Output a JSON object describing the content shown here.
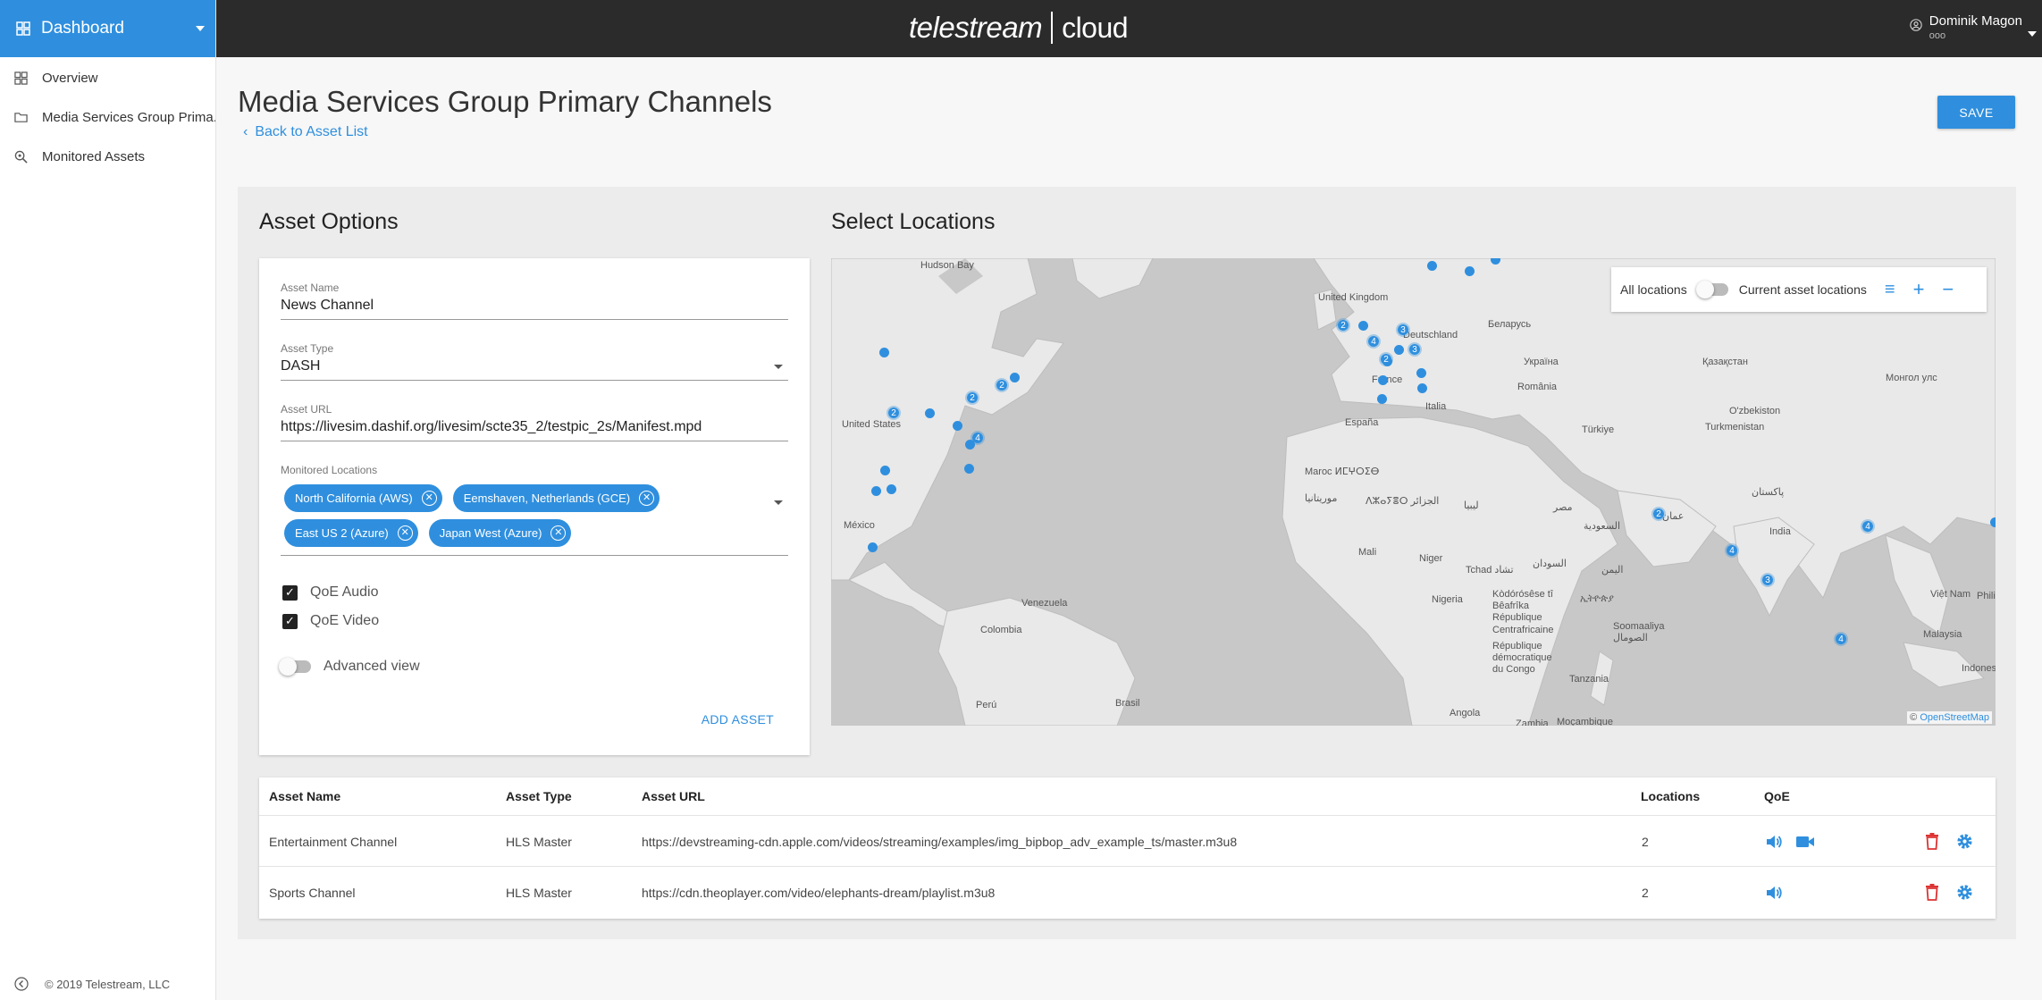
{
  "sidebar": {
    "header": "Dashboard",
    "items": [
      {
        "label": "Overview"
      },
      {
        "label": "Media Services Group Prima..."
      },
      {
        "label": "Monitored Assets"
      }
    ],
    "footer": "© 2019 Telestream, LLC"
  },
  "topbar": {
    "logo_brand": "telestream",
    "logo_product": "cloud",
    "user_name": "Dominik Magon",
    "user_sub": "ooo"
  },
  "page": {
    "title": "Media Services Group Primary Channels",
    "back_link": "Back to Asset List",
    "save_label": "SAVE"
  },
  "asset_options": {
    "heading": "Asset Options",
    "asset_name_label": "Asset Name",
    "asset_name": "News Channel",
    "asset_type_label": "Asset Type",
    "asset_type": "DASH",
    "asset_url_label": "Asset URL",
    "asset_url": "https://livesim.dashif.org/livesim/scte35_2/testpic_2s/Manifest.mpd",
    "monitored_label": "Monitored Locations",
    "locations": [
      "North California (AWS)",
      "Eemshaven, Netherlands (GCE)",
      "East US 2 (Azure)",
      "Japan West (Azure)"
    ],
    "qoe_audio": "QoE Audio",
    "qoe_video": "QoE Video",
    "advanced_view": "Advanced view",
    "add_asset": "ADD ASSET"
  },
  "map": {
    "heading": "Select Locations",
    "all_locations": "All locations",
    "current_locations": "Current asset locations",
    "attribution_prefix": "©",
    "attribution_link": "OpenStreetMap",
    "labels": [
      "Hudson Bay",
      "United Kingdom",
      "Deutschland",
      "Беларусь",
      "Україна",
      "Қазақстан",
      "Монгол улс",
      "United States",
      "France",
      "España",
      "Italia",
      "România",
      "Türkiye",
      "O'zbekiston",
      "Turkmenistan",
      "پاکستان",
      "India",
      "México",
      "Maroc ⵍⵎⵖⵔⵉⴱ",
      "ⴷⵣⴰⵢⴻⵔ الجزائر",
      "ليبيا",
      "مصر",
      "السعودية",
      "عمان",
      "Mali",
      "Niger",
      "Tchad تشاد",
      "السودان",
      "اليمن",
      "Venezuela",
      "Colombia",
      "Nigeria",
      "Kòdórósêse tî Bêafrîka République Centrafricaine",
      "ኢትዮጵያ",
      "Soomaaliya الصومال",
      "République démocratique du Congo",
      "Tanzania",
      "Perú",
      "Brasil",
      "Angola",
      "Zambia",
      "Moçambique",
      "Việt Nam",
      "Malaysia",
      "Indonesia",
      "موريتانيا",
      "Philip"
    ],
    "clusters": [
      "2",
      "2",
      "2",
      "4",
      "2",
      "4",
      "3",
      "3",
      "2",
      "4",
      "2",
      "4",
      "4",
      "3"
    ]
  },
  "table": {
    "headers": [
      "Asset Name",
      "Asset Type",
      "Asset URL",
      "Locations",
      "QoE"
    ],
    "rows": [
      {
        "name": "Entertainment Channel",
        "type": "HLS Master",
        "url": "https://devstreaming-cdn.apple.com/videos/streaming/examples/img_bipbop_adv_example_ts/master.m3u8",
        "locations": "2"
      },
      {
        "name": "Sports Channel",
        "type": "HLS Master",
        "url": "https://cdn.theoplayer.com/video/elephants-dream/playlist.m3u8",
        "locations": "2"
      }
    ]
  },
  "colors": {
    "accent": "#2f8fde",
    "topbar": "#2b2b2b",
    "delete": "#dd3333"
  }
}
